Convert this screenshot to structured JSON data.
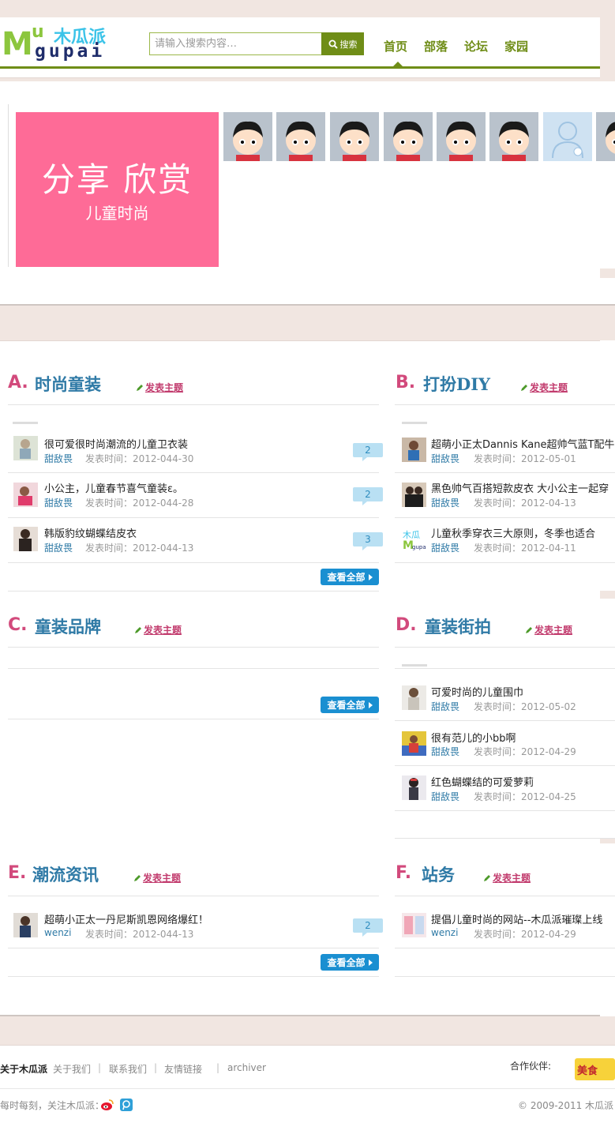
{
  "header": {
    "logo": {
      "m": "M",
      "u": "u",
      "cn": "木瓜派",
      "pinyin": "gupai"
    },
    "search_placeholder": "请输入搜索内容…",
    "search_button": "搜索",
    "nav": [
      "首页",
      "部落",
      "论坛",
      "家园"
    ]
  },
  "banner": {
    "line1": "分享 欣赏",
    "line2": "儿童时尚"
  },
  "sections": {
    "A": {
      "letter": "A.",
      "title": "时尚童装",
      "post_link": "发表主题",
      "items": [
        {
          "title": "很可爱很时尚潮流的儿童卫衣装",
          "author": "甜敌畏",
          "time": "发表时间：2012-044-30",
          "count": "2"
        },
        {
          "title": "小公主，儿童春节喜气童装ε。",
          "author": "甜敌畏",
          "time": "发表时间：2012-044-28",
          "count": "2"
        },
        {
          "title": "韩版豹纹蝴蝶结皮衣",
          "author": "甜敌畏",
          "time": "发表时间：2012-044-13",
          "count": "3"
        }
      ],
      "view_all": "查看全部"
    },
    "B": {
      "letter": "B.",
      "title": "打扮DIY",
      "post_link": "发表主题",
      "items": [
        {
          "title": "超萌小正太Dannis Kane超帅气蓝T配牛",
          "author": "甜敌畏",
          "time": "发表时间：2012-05-01"
        },
        {
          "title": "黑色帅气百搭短款皮衣 大小公主一起穿",
          "author": "甜敌畏",
          "time": "发表时间：2012-04-13"
        },
        {
          "title": "儿童秋季穿衣三大原则，冬季也适合",
          "author": "甜敌畏",
          "time": "发表时间：2012-04-11"
        }
      ]
    },
    "C": {
      "letter": "C.",
      "title": "童装品牌",
      "post_link": "发表主题",
      "view_all": "查看全部"
    },
    "D": {
      "letter": "D.",
      "title": "童装街拍",
      "post_link": "发表主题",
      "items": [
        {
          "title": "可爱时尚的儿童围巾",
          "author": "甜敌畏",
          "time": "发表时间：2012-05-02"
        },
        {
          "title": "很有范儿的小bb啊",
          "author": "甜敌畏",
          "time": "发表时间：2012-04-29"
        },
        {
          "title": "红色蝴蝶结的可爱萝莉",
          "author": "甜敌畏",
          "time": "发表时间：2012-04-25"
        }
      ]
    },
    "E": {
      "letter": "E.",
      "title": "潮流资讯",
      "post_link": "发表主题",
      "items": [
        {
          "title": "超萌小正太一丹尼斯凯恩网络爆红！",
          "author": "wenzi",
          "time": "发表时间：2012-044-13",
          "count": "2"
        }
      ],
      "view_all": "查看全部"
    },
    "F": {
      "letter": "F.",
      "title": "站务",
      "post_link": "发表主题",
      "items": [
        {
          "title": "提倡儿童时尚的网站--木瓜派璀璨上线",
          "author": "wenzi",
          "time": "发表时间：2012-04-29"
        }
      ]
    }
  },
  "footer": {
    "about": "关于木瓜派",
    "links": [
      "关于我们",
      "联系我们",
      "友情链接",
      "archiver"
    ],
    "partners_label": "合作伙伴:",
    "partner_badge": "美食",
    "follow": "每时每刻，关注木瓜派：",
    "copyright": "© 2009-2011 木瓜派"
  },
  "colors": {
    "brand_green": "#6f8d17",
    "banner_pink": "#fe6b97",
    "title_blue": "#2f7aa6",
    "letter_pink": "#d24a7c",
    "button_blue": "#1a8fd1"
  }
}
